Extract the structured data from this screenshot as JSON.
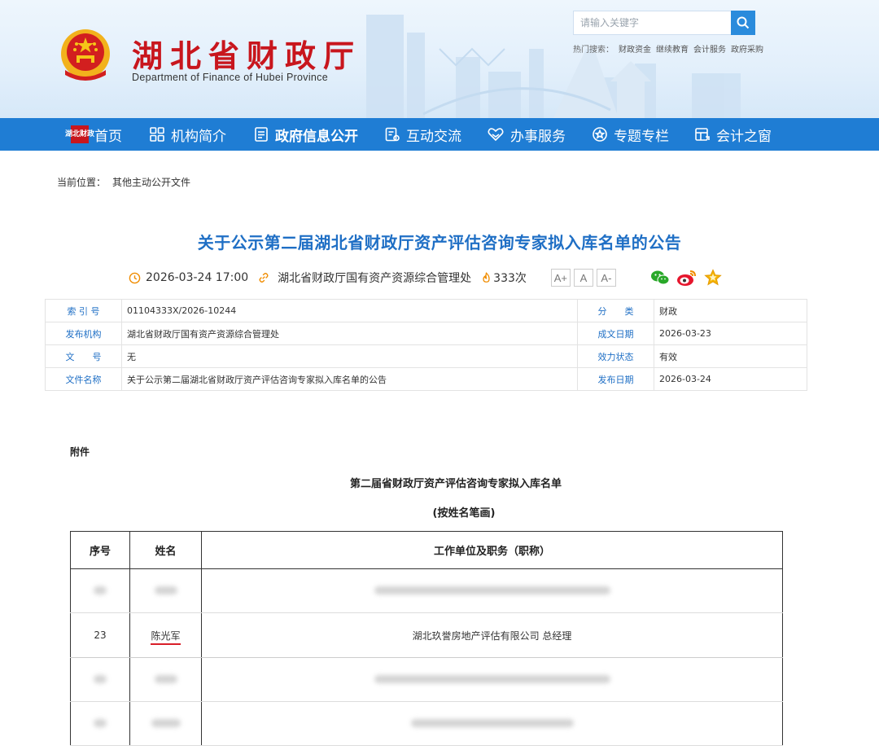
{
  "header": {
    "title": "湖北省财政厅",
    "subtitle": "Department of Finance of Hubei Province",
    "search": {
      "placeholder": "请输入关键字"
    },
    "hot_label": "热门搜索：",
    "hot_items": [
      "财政资金",
      "继续教育",
      "会计服务",
      "政府采购"
    ]
  },
  "nav": {
    "home_badge": "湖北财政",
    "items": [
      {
        "label": "首页",
        "icon": "home-badge"
      },
      {
        "label": "机构简介",
        "icon": "grid-icon"
      },
      {
        "label": "政府信息公开",
        "icon": "document-icon"
      },
      {
        "label": "互动交流",
        "icon": "chat-form-icon"
      },
      {
        "label": "办事服务",
        "icon": "heart-hands-icon"
      },
      {
        "label": "专题专栏",
        "icon": "star-circle-icon"
      },
      {
        "label": "会计之窗",
        "icon": "window-icon"
      }
    ]
  },
  "breadcrumb": {
    "label": "当前位置：",
    "current": "其他主动公开文件"
  },
  "article": {
    "title": "关于公示第二届湖北省财政厅资产评估咨询专家拟入库名单的公告",
    "meta": {
      "datetime": "2026-03-24 17:00",
      "source": "湖北省财政厅国有资产资源综合管理处",
      "views": "333次",
      "font_sizes": [
        "A+",
        "A",
        "A-"
      ]
    }
  },
  "info_table": [
    {
      "k1": "索 引 号",
      "v1": "01104333X/2026-10244",
      "k2": "分　　类",
      "v2": "财政"
    },
    {
      "k1": "发布机构",
      "v1": "湖北省财政厅国有资产资源综合管理处",
      "k2": "成文日期",
      "v2": "2026-03-23"
    },
    {
      "k1": "文　　号",
      "v1": "无",
      "k2": "效力状态",
      "v2": "有效"
    },
    {
      "k1": "文件名称",
      "v1": "关于公示第二届湖北省财政厅资产评估咨询专家拟入库名单的公告",
      "k2": "发布日期",
      "v2": "2026-03-24"
    }
  ],
  "body": {
    "attachment_label": "附件",
    "list_title": "第二届省财政厅资产评估咨询专家拟入库名单",
    "list_subtitle": "(按姓名笔画)",
    "table_headers": [
      "序号",
      "姓名",
      "工作单位及职务（职称）"
    ],
    "visible_row": {
      "no": "23",
      "name": "陈光军",
      "org": "湖北玖誉房地产评估有限公司 总经理"
    }
  },
  "colors": {
    "brand_red": "#c8161d",
    "nav_blue": "#1f7dd4",
    "title_blue": "#1f6fc5",
    "accent_orange": "#f08c00"
  }
}
